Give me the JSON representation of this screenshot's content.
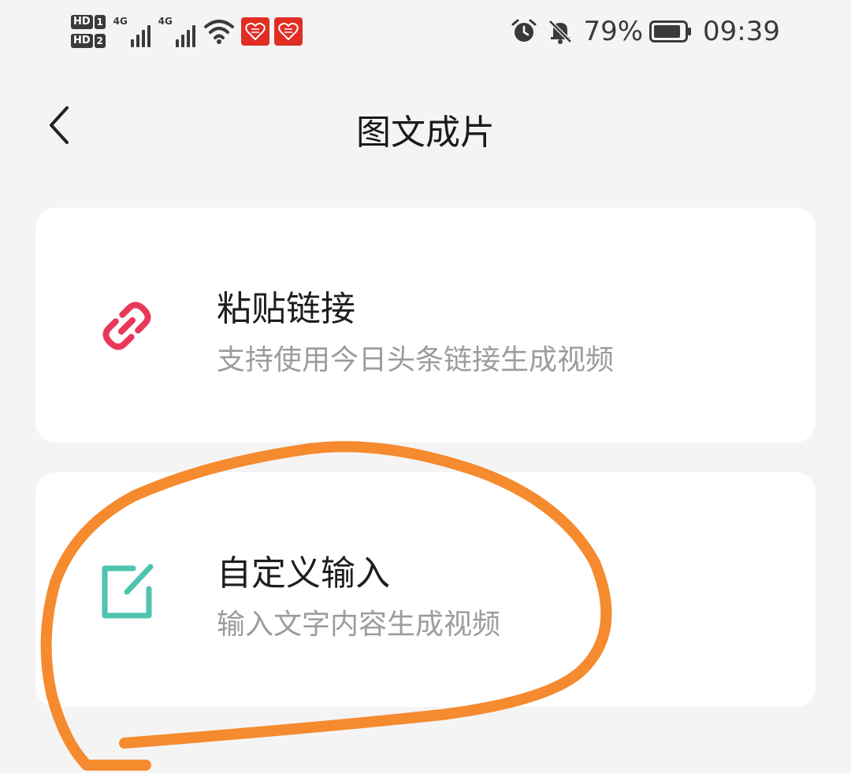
{
  "status_bar": {
    "sim1_label": "HD",
    "sim1_num": "1",
    "sim2_label": "HD",
    "sim2_num": "2",
    "network1": "4G",
    "network2": "4G",
    "battery_percent": "79%",
    "time": "09:39",
    "icons": [
      "signal-icon",
      "wifi-icon",
      "app-notification-icon",
      "alarm-icon",
      "mute-bell-icon",
      "battery-icon"
    ]
  },
  "header": {
    "title": "图文成片",
    "back_icon": "chevron-left-icon"
  },
  "options": [
    {
      "title": "粘贴链接",
      "subtitle": "支持使用今日头条链接生成视频",
      "icon": "link-icon",
      "icon_color": "#e8395a"
    },
    {
      "title": "自定义输入",
      "subtitle": "输入文字内容生成视频",
      "icon": "edit-icon",
      "icon_color": "#4ec3b0"
    }
  ],
  "colors": {
    "background": "#f4f4f4",
    "card": "#ffffff",
    "annotation_stroke": "#f58a2e"
  }
}
